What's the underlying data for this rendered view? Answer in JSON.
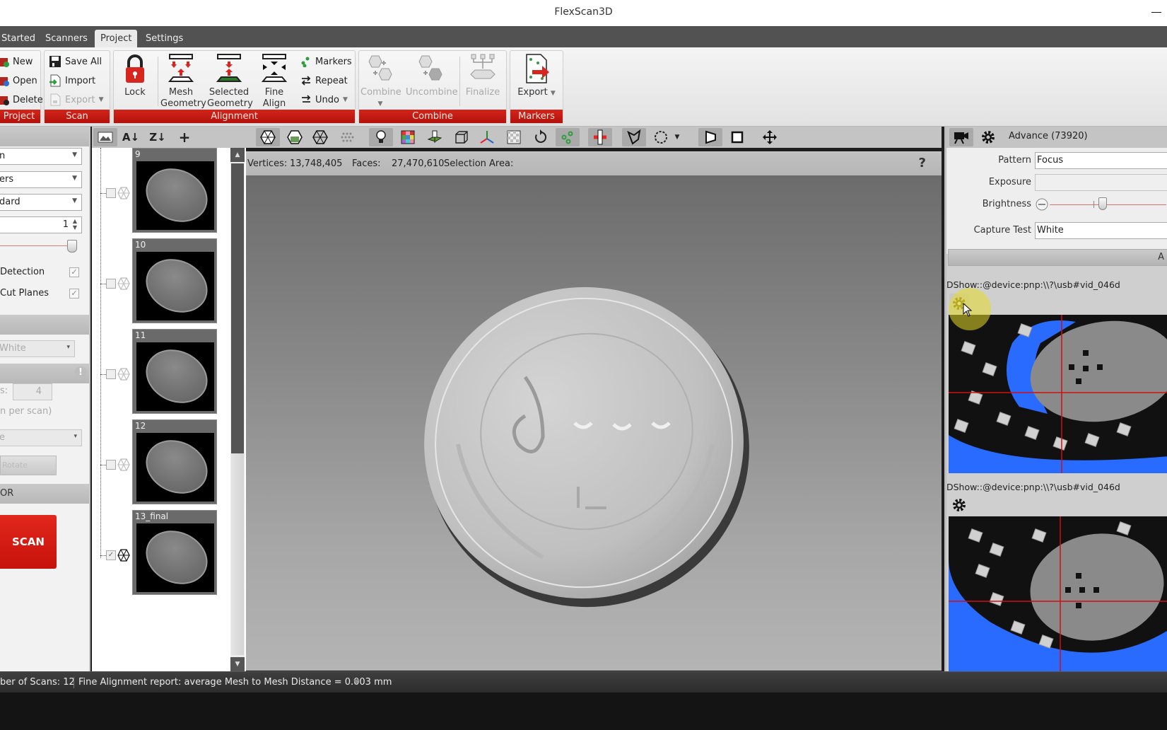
{
  "window": {
    "title": "FlexScan3D"
  },
  "ribbon_tabs": [
    {
      "label": "Started",
      "active": false
    },
    {
      "label": "Scanners",
      "active": false
    },
    {
      "label": "Project",
      "active": true
    },
    {
      "label": "Settings",
      "active": false
    }
  ],
  "ribbon": {
    "project": {
      "label": "Project",
      "new": "New",
      "open": "Open",
      "delete": "Delete"
    },
    "scan": {
      "label": "Scan",
      "save_all": "Save All",
      "import": "Import",
      "export": "Export"
    },
    "alignment": {
      "label": "Alignment",
      "lock": "Lock",
      "mesh_geometry": [
        "Mesh",
        "Geometry"
      ],
      "selected_geometry": [
        "Selected",
        "Geometry"
      ],
      "fine_align": "Fine Align",
      "markers": "Markers",
      "repeat": "Repeat",
      "undo": "Undo"
    },
    "combine": {
      "label": "Combine",
      "combine": "Combine",
      "uncombine": "Uncombine",
      "finalize": "Finalize"
    },
    "markers": {
      "label": "Markers",
      "export": "Export"
    }
  },
  "left_panel": {
    "combo1": "n",
    "combo2": "ers",
    "combo3": "dard",
    "spinner_value": "1",
    "check1_label": "Detection",
    "check1_checked": true,
    "check2_label": "Cut Planes",
    "check2_checked": true,
    "pattern_combo": "White",
    "scans_label": "s:",
    "scans_value": "4",
    "per_scan_note": "n per scan)",
    "combo4": "e",
    "disabled_button": "Rotate",
    "section_or": "OR",
    "scan_button": "SCAN"
  },
  "scan_list": {
    "items": [
      {
        "name": "9",
        "checked": false
      },
      {
        "name": "10",
        "checked": false
      },
      {
        "name": "11",
        "checked": false
      },
      {
        "name": "12",
        "checked": false
      },
      {
        "name": "13_final",
        "checked": true
      }
    ]
  },
  "viewport": {
    "vertices_label": "Vertices:",
    "vertices_value": "13,748,405",
    "faces_label": "Faces:",
    "faces_value": "27,470,610",
    "selection_label": "Selection Area:",
    "help": "?"
  },
  "right_panel": {
    "title": "Advance (73920)",
    "pattern_label": "Pattern",
    "pattern_value": "Focus",
    "exposure_label": "Exposure",
    "exposure_value": "",
    "brightness_label": "Brightness",
    "capture_test_label": "Capture Test",
    "capture_test_value": "White",
    "apply_button": "A",
    "camera1_path": "DShow::@device:pnp:\\\\?\\usb#vid_046d",
    "camera2_path": "DShow::@device:pnp:\\\\?\\usb#vid_046d"
  },
  "status_bar": {
    "scans_count": "ber of Scans:  12",
    "report": "Fine Alignment report: average Mesh to Mesh Distance = 0.003 mm"
  },
  "colors": {
    "accent_red": "#c8160f",
    "tab_bar": "#525252",
    "camera_blue": "#2a6bff"
  }
}
